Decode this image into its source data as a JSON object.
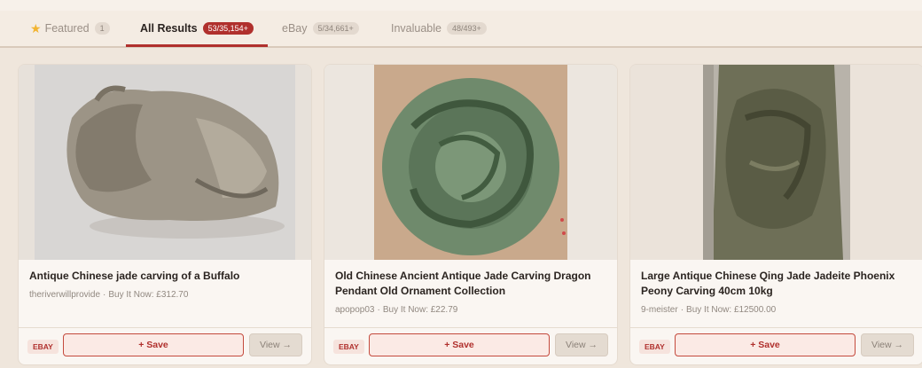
{
  "tabs": [
    {
      "label": "Featured",
      "count": "1",
      "icon": "star-icon",
      "active": false
    },
    {
      "label": "All Results",
      "count": "53/35,154+",
      "active": true
    },
    {
      "label": "eBay",
      "count": "5/34,661+",
      "active": false
    },
    {
      "label": "Invaluable",
      "count": "48/493+",
      "active": false
    }
  ],
  "colors": {
    "accent": "#b0302d",
    "background": "#efe6dc",
    "card": "#faf6f2"
  },
  "cards": [
    {
      "image_desc_icon": "jade-buffalo-image",
      "title": "Antique Chinese jade carving of a Buffalo",
      "seller": "theriverwillprovide",
      "price": "Buy It Now: £312.70",
      "source_badge": "EBAY",
      "save_label": "+ Save",
      "view_label": "View →"
    },
    {
      "image_desc_icon": "jade-dragon-pendant-image",
      "title": "Old Chinese Ancient Antique Jade Carving Dragon Pendant Old Ornament Collection",
      "seller": "apopop03",
      "price": "Buy It Now: £22.79",
      "source_badge": "EBAY",
      "save_label": "+ Save",
      "view_label": "View →"
    },
    {
      "image_desc_icon": "jade-phoenix-carving-image",
      "title": "Large Antique Chinese Qing Jade Jadeite Phoenix Peony Carving 40cm 10kg",
      "seller": "9-meister",
      "price": "Buy It Now: £12500.00",
      "source_badge": "EBAY",
      "save_label": "+ Save",
      "view_label": "View →"
    }
  ]
}
